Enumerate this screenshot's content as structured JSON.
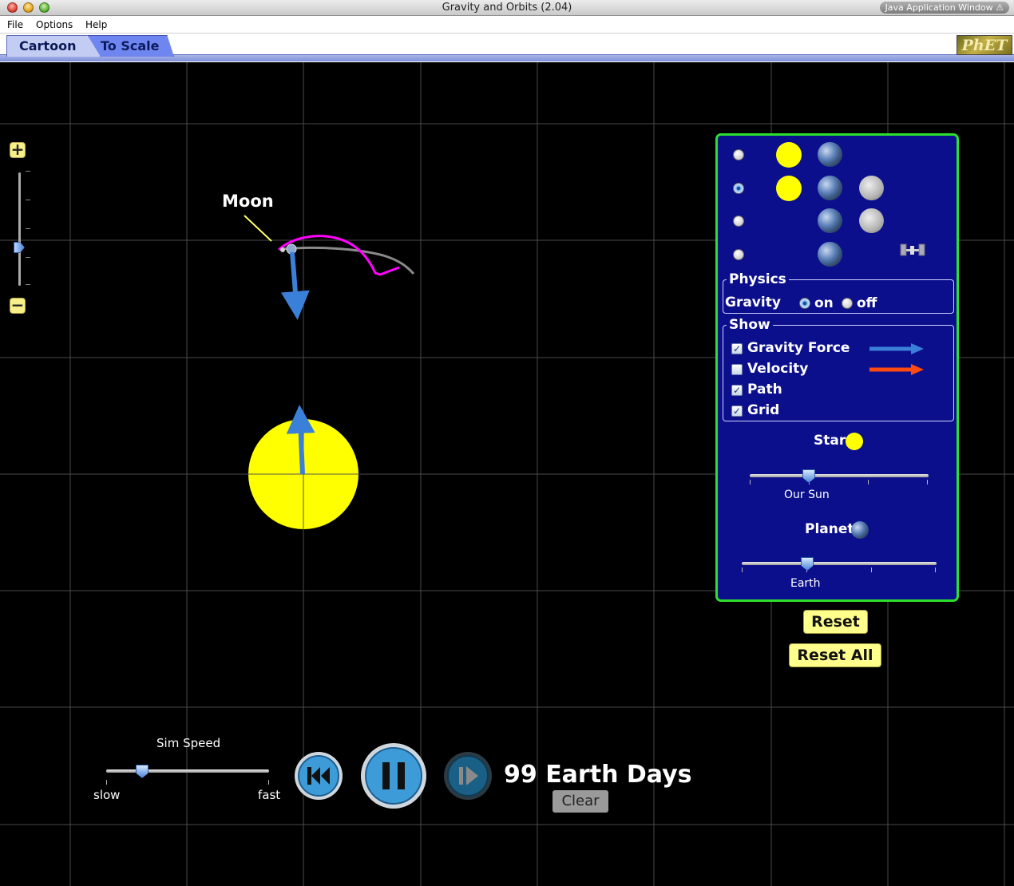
{
  "window": {
    "title": "Gravity and Orbits (2.04)",
    "badge": "Java Application Window"
  },
  "menu": {
    "file": "File",
    "options": "Options",
    "help": "Help"
  },
  "tabs": {
    "cartoon": "Cartoon",
    "to_scale": "To Scale",
    "active": "Cartoon"
  },
  "logo": "PhET",
  "scene": {
    "moon_label": "Moon",
    "zoom_level_fraction": 0.33
  },
  "panel": {
    "presets_selected": 2,
    "physics": {
      "title": "Physics",
      "gravity_label": "Gravity",
      "on_label": "on",
      "off_label": "off",
      "gravity": "on"
    },
    "show": {
      "title": "Show",
      "items": [
        {
          "label": "Gravity Force",
          "checked": true,
          "arrow_color": "#3a7fd8"
        },
        {
          "label": "Velocity",
          "checked": false,
          "arrow_color": "#ff4a10"
        },
        {
          "label": "Path",
          "checked": true
        },
        {
          "label": "Grid",
          "checked": true
        }
      ]
    },
    "star": {
      "label": "Star",
      "value_label": "Our Sun"
    },
    "planet": {
      "label": "Planet",
      "value_label": "Earth"
    }
  },
  "buttons": {
    "reset": "Reset",
    "reset_all": "Reset All",
    "clear": "Clear"
  },
  "sim": {
    "speed_label": "Sim Speed",
    "slow": "slow",
    "fast": "fast",
    "speed_fraction": 0.22,
    "elapsed": "99 Earth Days"
  },
  "colors": {
    "panel_bg": "#0c0f8c",
    "panel_border": "#2ce02c",
    "sun": "#ffff00",
    "moon_path": "#ff00ff",
    "earth_path": "#888888",
    "gravity_arrow": "#3a7fd8"
  }
}
